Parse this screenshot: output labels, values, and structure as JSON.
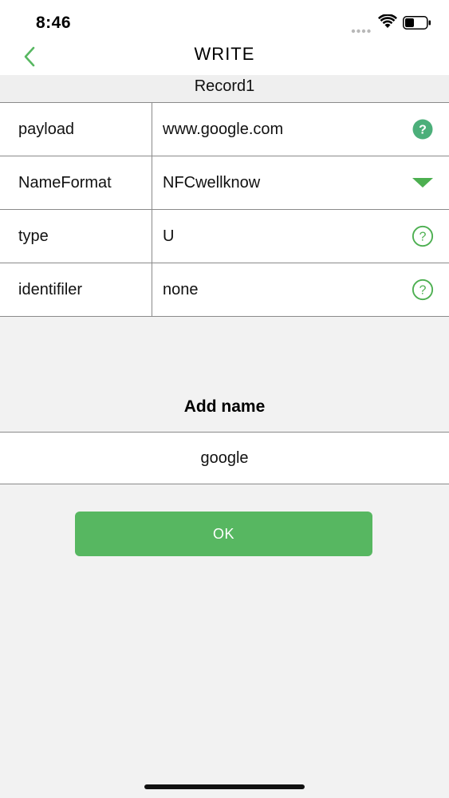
{
  "status_bar": {
    "time": "8:46",
    "icons": [
      "signal-icon",
      "wifi-icon",
      "battery-icon"
    ]
  },
  "nav": {
    "title": "WRITE",
    "back_icon": "chevron-left-icon"
  },
  "record": {
    "header": "Record1",
    "rows": [
      {
        "key": "payload",
        "value": "www.google.com",
        "action_icon": "help-filled-icon"
      },
      {
        "key": "NameFormat",
        "value": "NFCwellknow",
        "action_icon": "dropdown-triangle-icon"
      },
      {
        "key": "type",
        "value": "U",
        "action_icon": "help-outline-icon"
      },
      {
        "key": "identifiler",
        "value": "none",
        "action_icon": "help-outline-icon"
      }
    ]
  },
  "add_name": {
    "title": "Add name",
    "input_value": "google"
  },
  "ok_button": {
    "label": "OK"
  },
  "colors": {
    "accent_green": "#57b761",
    "icon_green": "#4caf50",
    "background": "#f2f2f2",
    "divider": "#8a8a8a"
  }
}
